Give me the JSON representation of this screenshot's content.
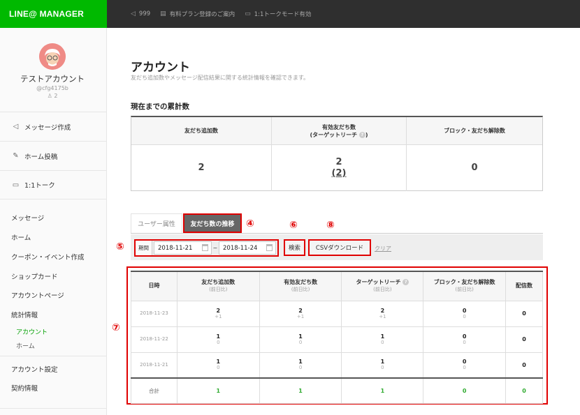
{
  "app": {
    "logo": "LINE@ MANAGER"
  },
  "topbar": {
    "items": [
      {
        "icon": "speaker-icon",
        "label": "999"
      },
      {
        "icon": "document-icon",
        "label": "有料プラン登録のご案内"
      },
      {
        "icon": "chat-icon",
        "label": "1:1トークモード有効"
      }
    ]
  },
  "account": {
    "name": "テストアカウント",
    "id": "@cfg4175b",
    "friends": "2"
  },
  "sidebar": {
    "buttons": [
      {
        "icon": "speaker-icon",
        "label": "メッセージ作成"
      },
      {
        "icon": "edit-icon",
        "label": "ホーム投稿"
      },
      {
        "icon": "chat-icon",
        "label": "1:1トーク"
      }
    ],
    "links": [
      "メッセージ",
      "ホーム",
      "クーポン・イベント作成",
      "ショップカード",
      "アカウントページ",
      "統計情報"
    ],
    "sub_links": [
      "アカウント",
      "ホーム"
    ],
    "bottom_links": [
      "アカウント設定",
      "契約情報"
    ]
  },
  "page": {
    "title": "アカウント",
    "description": "友だち追加数やメッセージ配信結果に関する統計情報を確認できます。",
    "section_title": "現在までの累計数"
  },
  "cumulative": {
    "added_label": "友だち追加数",
    "effective_label_1": "有効友だち数",
    "effective_label_2": "(ターゲットリーチ",
    "effective_label_3": ")",
    "blocked_label": "ブロック・友だち解除数",
    "added_value": "2",
    "effective_value": "2",
    "effective_sub": "(2)",
    "blocked_value": "0"
  },
  "tabs": {
    "user_attr": "ユーザー属性",
    "friend_trend": "友だち数の推移"
  },
  "markers": {
    "m4": "④",
    "m5": "⑤",
    "m6": "⑥",
    "m7": "⑦",
    "m8": "⑧"
  },
  "filter": {
    "period_label": "期間",
    "start_date": "2018-11-21",
    "separator": "~",
    "end_date": "2018-11-24",
    "search_label": "検索",
    "csv_label": "CSVダウンロード",
    "clear_label": "クリア"
  },
  "stats": {
    "headers": {
      "date": "日時",
      "added": "友だち追加数",
      "effective": "有効友だち数",
      "target": "ターゲットリーチ",
      "blocked": "ブロック・友だち解除数",
      "delivered": "配信数",
      "prev_day": "(前日比)"
    },
    "rows": [
      {
        "date": "2018-11-23",
        "added": "2",
        "added_d": "+1",
        "effective": "2",
        "effective_d": "+1",
        "target": "2",
        "target_d": "+1",
        "blocked": "0",
        "blocked_d": "0",
        "delivered": "0"
      },
      {
        "date": "2018-11-22",
        "added": "1",
        "added_d": "0",
        "effective": "1",
        "effective_d": "0",
        "target": "1",
        "target_d": "0",
        "blocked": "0",
        "blocked_d": "0",
        "delivered": "0"
      },
      {
        "date": "2018-11-21",
        "added": "1",
        "added_d": "0",
        "effective": "1",
        "effective_d": "0",
        "target": "1",
        "target_d": "0",
        "blocked": "0",
        "blocked_d": "0",
        "delivered": "0"
      }
    ],
    "total": {
      "label": "合計",
      "added": "1",
      "effective": "1",
      "target": "1",
      "blocked": "0",
      "delivered": "0"
    }
  },
  "colors": {
    "brand": "#00b900",
    "highlight": "#e00000",
    "total_green": "#2eaa2e",
    "topbar": "#2f2f2f"
  }
}
